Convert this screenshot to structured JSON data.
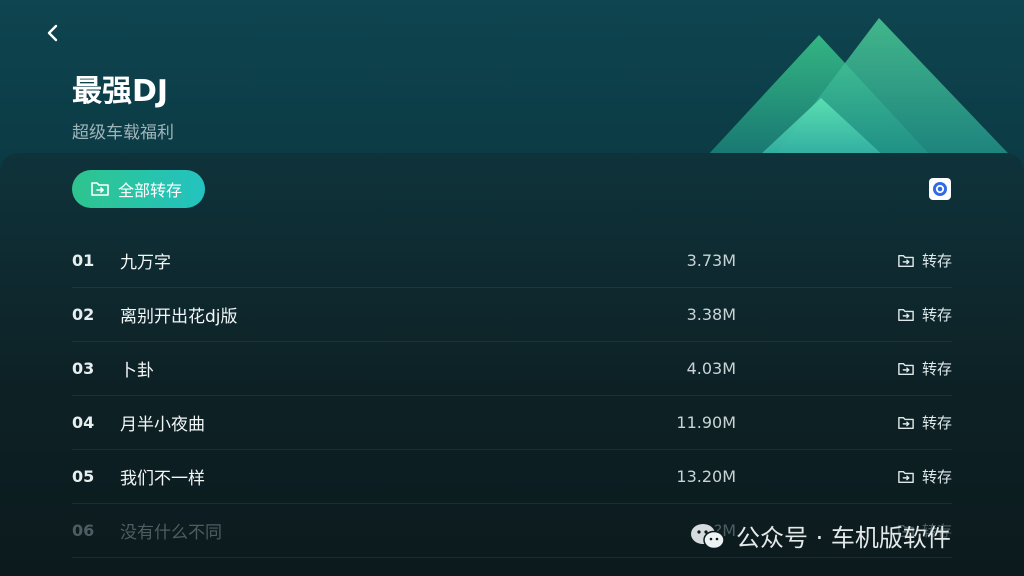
{
  "header": {
    "title": "最强DJ",
    "subtitle": "超级车载福利"
  },
  "actions": {
    "save_all_label": "全部转存"
  },
  "tracks": [
    {
      "num": "01",
      "name": "九万字",
      "size": "3.73M",
      "save_label": "转存"
    },
    {
      "num": "02",
      "name": "离别开出花dj版",
      "size": "3.38M",
      "save_label": "转存"
    },
    {
      "num": "03",
      "name": "卜卦",
      "size": "4.03M",
      "save_label": "转存"
    },
    {
      "num": "04",
      "name": "月半小夜曲",
      "size": "11.90M",
      "save_label": "转存"
    },
    {
      "num": "05",
      "name": "我们不一样",
      "size": "13.20M",
      "save_label": "转存"
    },
    {
      "num": "06",
      "name": "没有什么不同",
      "size": "5.?M",
      "save_label": "转存"
    }
  ],
  "watermark": {
    "text": "公众号 · 车机版软件"
  },
  "colors": {
    "accent_start": "#2ec48e",
    "accent_end": "#23c3c0",
    "background": "#0b2a33"
  },
  "icons": {
    "back": "chevron-left-icon",
    "save": "folder-arrow-icon",
    "corner": "app-icon",
    "watermark": "wechat-icon"
  }
}
